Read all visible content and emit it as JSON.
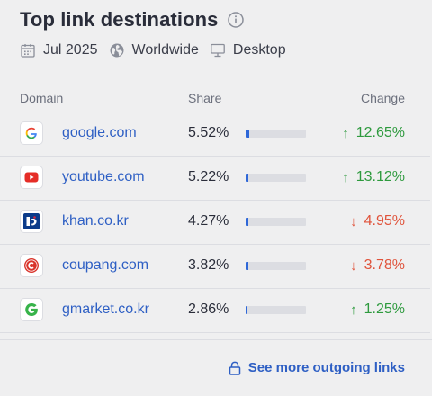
{
  "widget": {
    "title": "Top link destinations",
    "meta": {
      "date": "Jul 2025",
      "region": "Worldwide",
      "device": "Desktop"
    },
    "columns": {
      "domain": "Domain",
      "share": "Share",
      "change": "Change"
    },
    "rows": [
      {
        "domain": "google.com",
        "share": "5.52%",
        "share_value": 5.52,
        "change": "12.65%",
        "direction": "up",
        "icon": "google-icon"
      },
      {
        "domain": "youtube.com",
        "share": "5.22%",
        "share_value": 5.22,
        "change": "13.12%",
        "direction": "up",
        "icon": "youtube-icon"
      },
      {
        "domain": "khan.co.kr",
        "share": "4.27%",
        "share_value": 4.27,
        "change": "4.95%",
        "direction": "down",
        "icon": "khan-icon"
      },
      {
        "domain": "coupang.com",
        "share": "3.82%",
        "share_value": 3.82,
        "change": "3.78%",
        "direction": "down",
        "icon": "coupang-icon"
      },
      {
        "domain": "gmarket.co.kr",
        "share": "2.86%",
        "share_value": 2.86,
        "change": "1.25%",
        "direction": "up",
        "icon": "gmarket-icon"
      }
    ],
    "footer_link": "See more outgoing links"
  },
  "colors": {
    "link": "#2e5fc4",
    "bar": "#2e67d8",
    "up": "#2e9a3e",
    "down": "#e0533b"
  }
}
